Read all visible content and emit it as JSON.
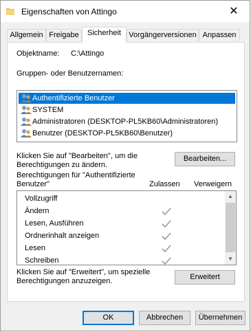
{
  "window": {
    "title": "Eigenschaften von Attingo",
    "close_glyph": "✕"
  },
  "tabs": [
    {
      "label": "Allgemein"
    },
    {
      "label": "Freigabe"
    },
    {
      "label": "Sicherheit",
      "active": true
    },
    {
      "label": "Vorgängerversionen"
    },
    {
      "label": "Anpassen"
    }
  ],
  "security": {
    "object_label": "Objektname:",
    "object_value": "C:\\Attingo",
    "groups_label": "Gruppen- oder Benutzernamen:",
    "groups": [
      {
        "name": "Authentifizierte Benutzer",
        "selected": true
      },
      {
        "name": "SYSTEM"
      },
      {
        "name": "Administratoren (DESKTOP-PL5KB60\\Administratoren)"
      },
      {
        "name": "Benutzer (DESKTOP-PL5KB60\\Benutzer)"
      }
    ],
    "edit_hint_1": "Klicken Sie auf \"Bearbeiten\", um die",
    "edit_hint_2": "Berechtigungen zu ändern.",
    "edit_button": "Bearbeiten...",
    "perm_for_1": "Berechtigungen für \"Authentifizierte",
    "perm_for_2": "Benutzer\"",
    "allow_header": "Zulassen",
    "deny_header": "Verweigern",
    "permissions": [
      {
        "name": "Vollzugriff",
        "allow": false
      },
      {
        "name": "Ändern",
        "allow": true
      },
      {
        "name": "Lesen, Ausführen",
        "allow": true
      },
      {
        "name": "Ordnerinhalt anzeigen",
        "allow": true
      },
      {
        "name": "Lesen",
        "allow": true
      },
      {
        "name": "Schreiben",
        "allow": true
      }
    ],
    "adv_hint_1": "Klicken Sie auf \"Erweitert\", um spezielle",
    "adv_hint_2": "Berechtigungen anzuzeigen.",
    "adv_button": "Erweitert"
  },
  "footer": {
    "ok": "OK",
    "cancel": "Abbrechen",
    "apply": "Übernehmen"
  },
  "colors": {
    "selection": "#0078d7",
    "check": "#9a9a9a",
    "folder": "#e8c15a"
  }
}
